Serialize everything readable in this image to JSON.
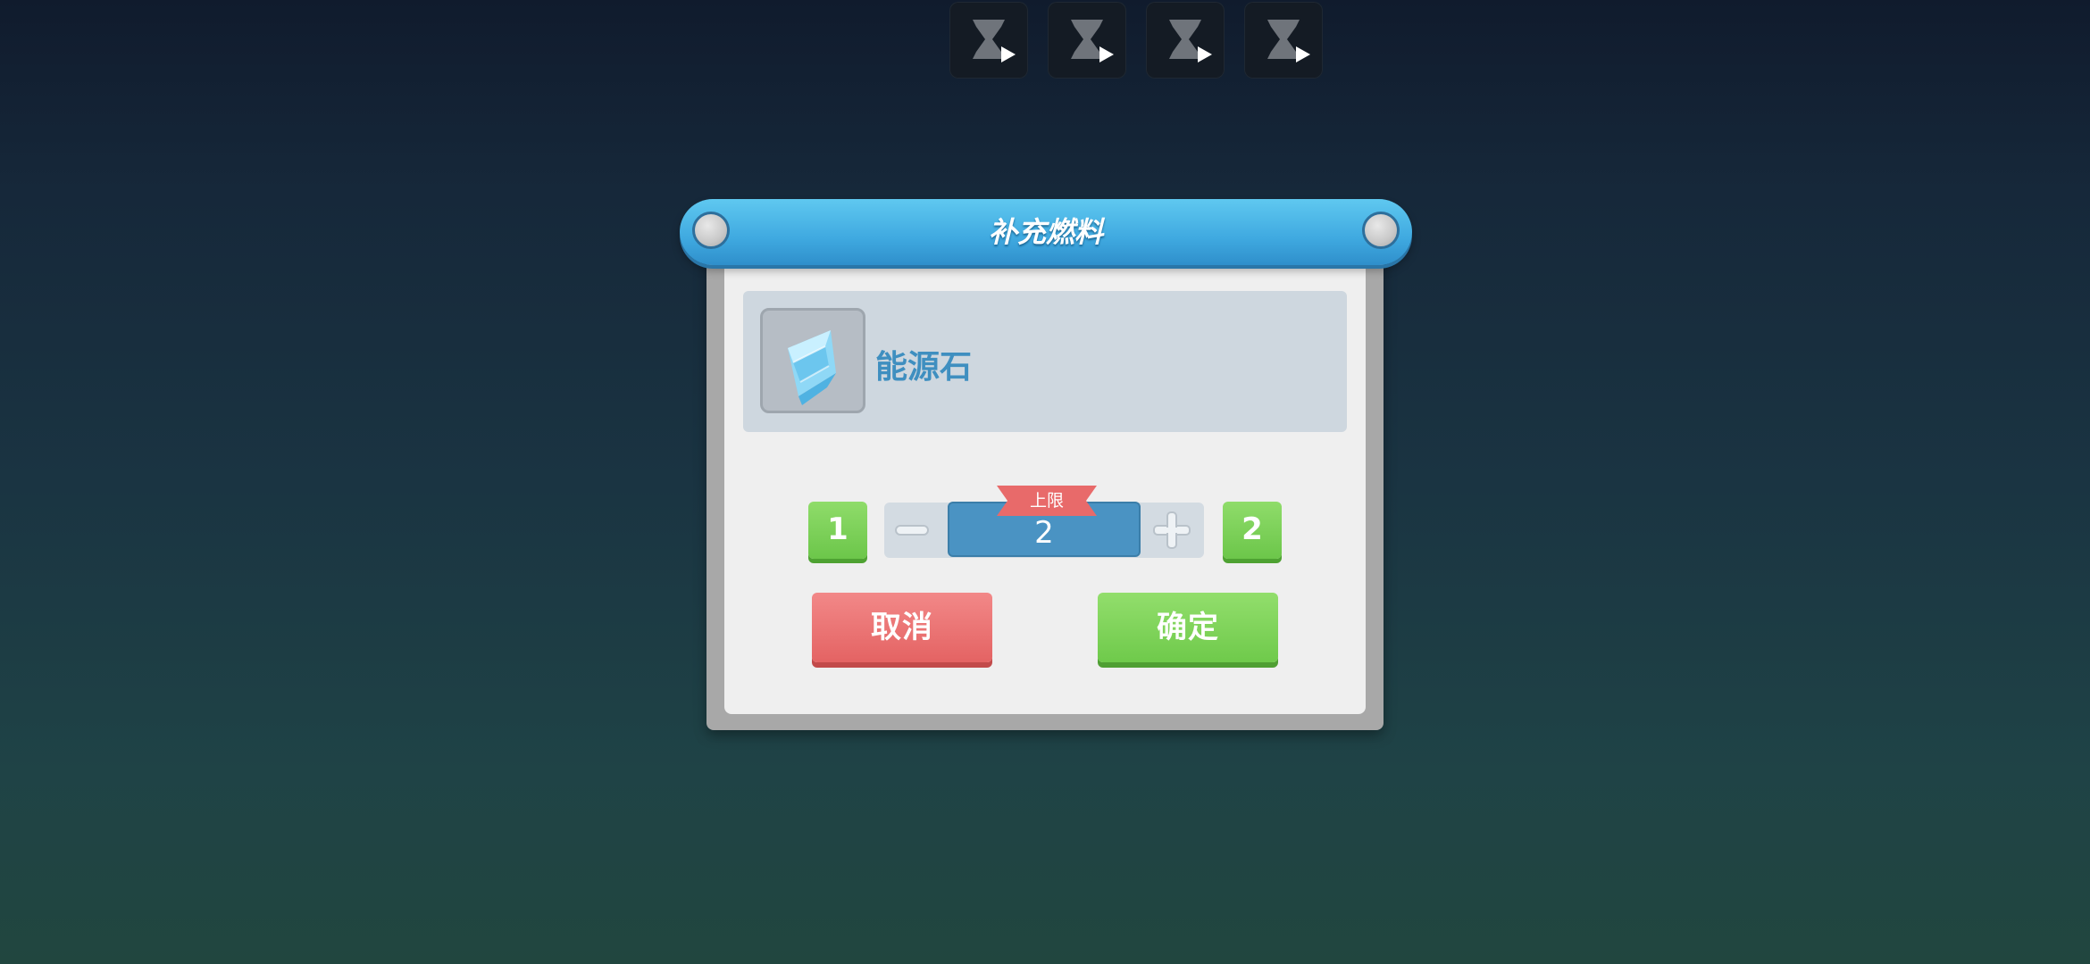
{
  "top_bar": {
    "slots": [
      {
        "icon": "hourglass-play-icon"
      },
      {
        "icon": "hourglass-play-icon"
      },
      {
        "icon": "hourglass-play-icon"
      },
      {
        "icon": "hourglass-play-icon"
      }
    ]
  },
  "dialog": {
    "title": "补充燃料",
    "item": {
      "name": "能源石",
      "icon": "energy-crystal-icon"
    },
    "quantity": {
      "min_label": "1",
      "max_label": "2",
      "value": "2",
      "limit_badge": "上限",
      "decrement_icon": "minus-icon",
      "increment_icon": "plus-icon"
    },
    "buttons": {
      "cancel": "取消",
      "confirm": "确定"
    }
  },
  "colors": {
    "title_bar": "#3fa9e0",
    "cancel": "#e46363",
    "confirm": "#6fca4b",
    "value_box": "#4a93c3",
    "limit_ribbon": "#e86a6a"
  }
}
